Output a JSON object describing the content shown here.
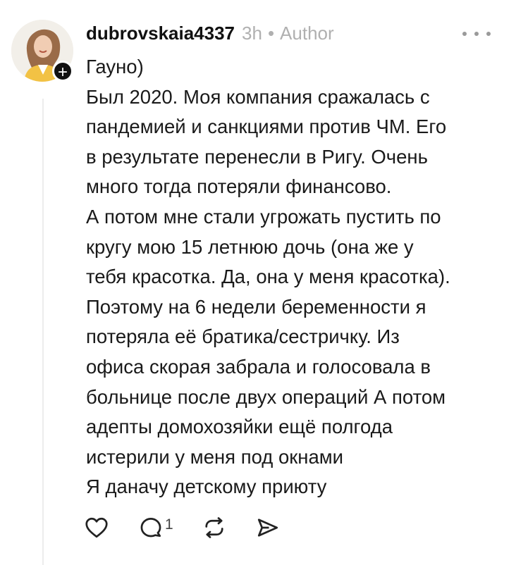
{
  "post": {
    "username": "dubrovskaia4337",
    "time": "3h",
    "separator": "•",
    "role": "Author",
    "follow_symbol": "+",
    "lines": [
      "Гауно)",
      "Был 2020. Моя компания сражалась с",
      "пандемией и санкциями против ЧМ. Его",
      "в результате перенесли в Ригу. Очень",
      "много тогда потеряли финансово.",
      "А потом мне стали угрожать пустить по",
      "кругу мою 15 летнюю дочь (она же у",
      "тебя красотка. Да, она у меня красотка).",
      "Поэтому на 6 недели беременности я",
      "потеряла её братика/сестричку. Из",
      "офиса скорая забрала и голосовала в",
      "больнице после двух операций А потом",
      "адепты домохозяйки ещё полгода",
      "истерили у меня под окнами",
      "Я даначу детскому приюту"
    ]
  },
  "actions": {
    "reply_count": "1",
    "icons": [
      "heart-icon",
      "comment-icon",
      "repost-icon",
      "share-icon",
      "more-icon"
    ]
  },
  "colors": {
    "text": "#1a1a1a",
    "meta": "#b0b0b0",
    "badge": "#111111"
  }
}
